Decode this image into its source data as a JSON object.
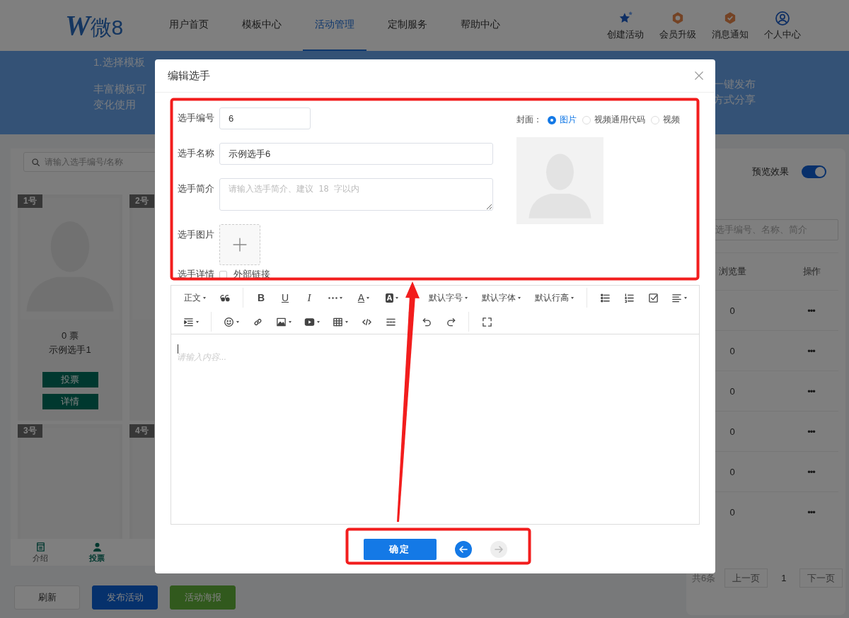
{
  "header": {
    "logo": {
      "initial": "W",
      "name": "微8"
    },
    "nav": [
      {
        "label": "用户首页",
        "selected": false
      },
      {
        "label": "模板中心",
        "selected": false
      },
      {
        "label": "活动管理",
        "selected": true
      },
      {
        "label": "定制服务",
        "selected": false
      },
      {
        "label": "帮助中心",
        "selected": false
      }
    ],
    "actions": [
      {
        "label": "创建活动"
      },
      {
        "label": "会员升级"
      },
      {
        "label": "消息通知"
      },
      {
        "label": "个人中心"
      }
    ]
  },
  "banner": {
    "step_title": "1.选择模板",
    "left_lines": [
      "丰富模板可",
      "变化使用"
    ],
    "right_lines": [
      "一键发布",
      "方式分享"
    ]
  },
  "preview": {
    "search_placeholder": "请输入选手编号/名称",
    "cards": [
      {
        "tag": "1号",
        "votes": "0 票",
        "name": "示例选手1",
        "buttons": [
          "投票",
          "详情"
        ]
      },
      {
        "tag": "2号"
      },
      {
        "tag": "3号"
      },
      {
        "tag": "4号"
      }
    ],
    "tabs": [
      {
        "label": "介绍",
        "selected": false
      },
      {
        "label": "投票",
        "selected": true
      }
    ]
  },
  "preview_toggle": {
    "label": "预览效果",
    "on": true
  },
  "table": {
    "search_placeholder": "选手编号、名称、简介",
    "columns": [
      "浏览量",
      "操作"
    ],
    "rows": [
      {
        "views": "0",
        "action": "•••"
      },
      {
        "views": "0",
        "action": "•••"
      },
      {
        "views": "0",
        "action": "•••"
      },
      {
        "views": "0",
        "action": "•••"
      },
      {
        "views": "0",
        "action": "•••"
      },
      {
        "views": "0",
        "action": "•••"
      }
    ]
  },
  "pagination": {
    "total": "共6条",
    "prev": "上一页",
    "page": "1",
    "next": "下一页"
  },
  "page_buttons": [
    {
      "label": "刷新",
      "kind": "default"
    },
    {
      "label": "发布活动",
      "kind": "primary"
    },
    {
      "label": "活动海报",
      "kind": "success"
    }
  ],
  "dialog": {
    "title": "编辑选手",
    "fields": [
      {
        "kind": "number",
        "label": "选手编号",
        "value": "6"
      },
      {
        "kind": "input",
        "label": "选手名称",
        "value": "示例选手6"
      },
      {
        "kind": "textarea",
        "label": "选手简介",
        "placeholder": "请输入选手简介、建议 18 字以内"
      },
      {
        "kind": "upload",
        "label": "选手图片"
      },
      {
        "kind": "checkbox",
        "label": "选手详情",
        "option": "外部链接",
        "checked": false
      }
    ],
    "cover": {
      "label": "封面：",
      "options": [
        {
          "label": "图片",
          "selected": true
        },
        {
          "label": "视频通用代码",
          "selected": false
        },
        {
          "label": "视频",
          "selected": false
        }
      ]
    },
    "toolbar": [
      [
        {
          "kind": "menu",
          "label": "正文"
        },
        {
          "kind": "icon"
        },
        {
          "kind": "divider"
        },
        {
          "kind": "letter",
          "label": "B"
        },
        {
          "kind": "letter",
          "label": "U"
        },
        {
          "kind": "letter",
          "label": "I"
        },
        {
          "kind": "icon",
          "caret": true
        },
        {
          "kind": "letter",
          "label": "A",
          "caret": true
        },
        {
          "kind": "letter",
          "label": "A",
          "caret": true
        },
        {
          "kind": "menu",
          "label": "默认字号"
        },
        {
          "kind": "menu",
          "label": "默认字体"
        },
        {
          "kind": "menu",
          "label": "默认行高"
        },
        {
          "kind": "divider"
        },
        {
          "kind": "icon"
        },
        {
          "kind": "icon"
        },
        {
          "kind": "icon"
        },
        {
          "kind": "icon",
          "caret": true
        }
      ],
      [
        {
          "kind": "icon",
          "caret": true
        },
        {
          "kind": "divider"
        },
        {
          "kind": "icon",
          "caret": true
        },
        {
          "kind": "icon"
        },
        {
          "kind": "icon",
          "caret": true
        },
        {
          "kind": "icon",
          "caret": true
        },
        {
          "kind": "icon",
          "caret": true
        },
        {
          "kind": "icon"
        },
        {
          "kind": "icon"
        },
        {
          "kind": "divider"
        },
        {
          "kind": "icon"
        },
        {
          "kind": "icon"
        },
        {
          "kind": "divider"
        },
        {
          "kind": "icon"
        }
      ]
    ],
    "editor_placeholder": "请输入内容...",
    "confirm": "确定",
    "prev_enabled": true,
    "next_enabled": false
  }
}
